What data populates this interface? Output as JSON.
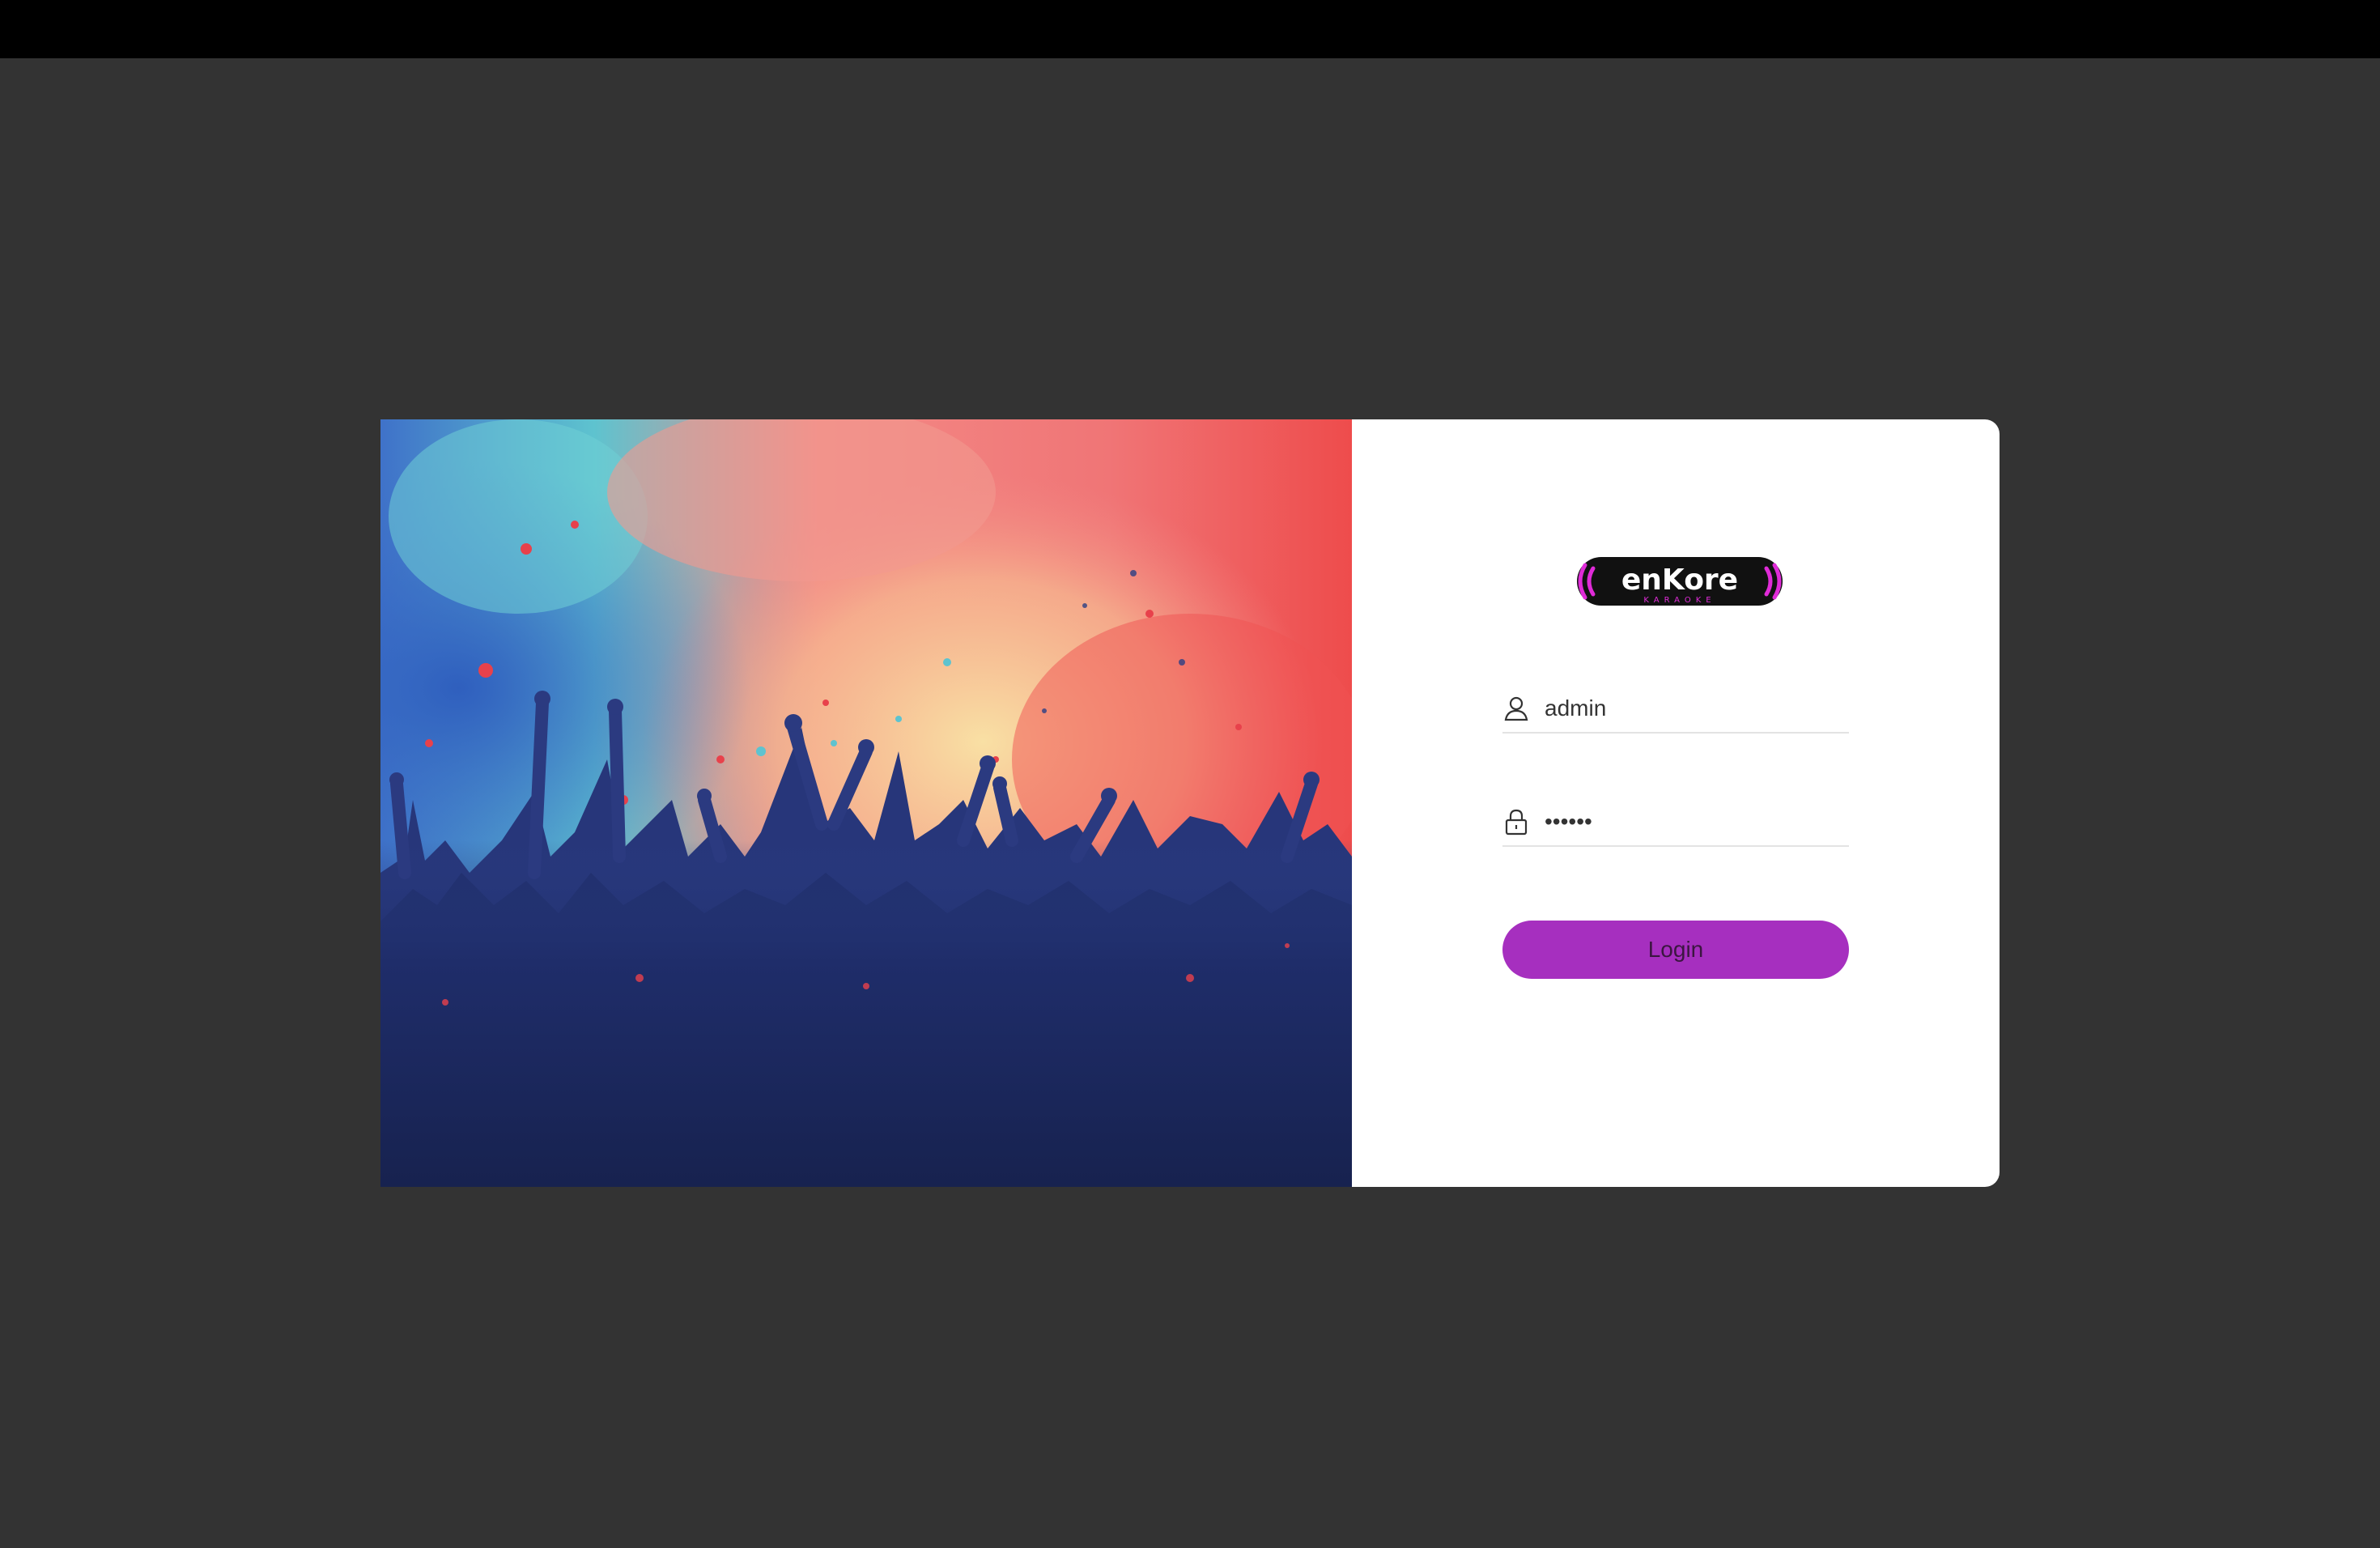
{
  "logo": {
    "text": "enKore",
    "subtext": "KARAOKE",
    "colors": {
      "ring": "#e02bd8",
      "text": "#ffffff",
      "subtext": "#e02bd8"
    }
  },
  "form": {
    "username": {
      "value": "admin",
      "icon": "user-icon"
    },
    "password": {
      "value": "••••••",
      "icon": "lock-icon"
    },
    "login_label": "Login"
  },
  "colors": {
    "background": "#333333",
    "topbar": "#000000",
    "accent": "#a62fbf",
    "panel": "#ffffff"
  },
  "hero": {
    "description_icon": "concert-crowd-illustration"
  }
}
